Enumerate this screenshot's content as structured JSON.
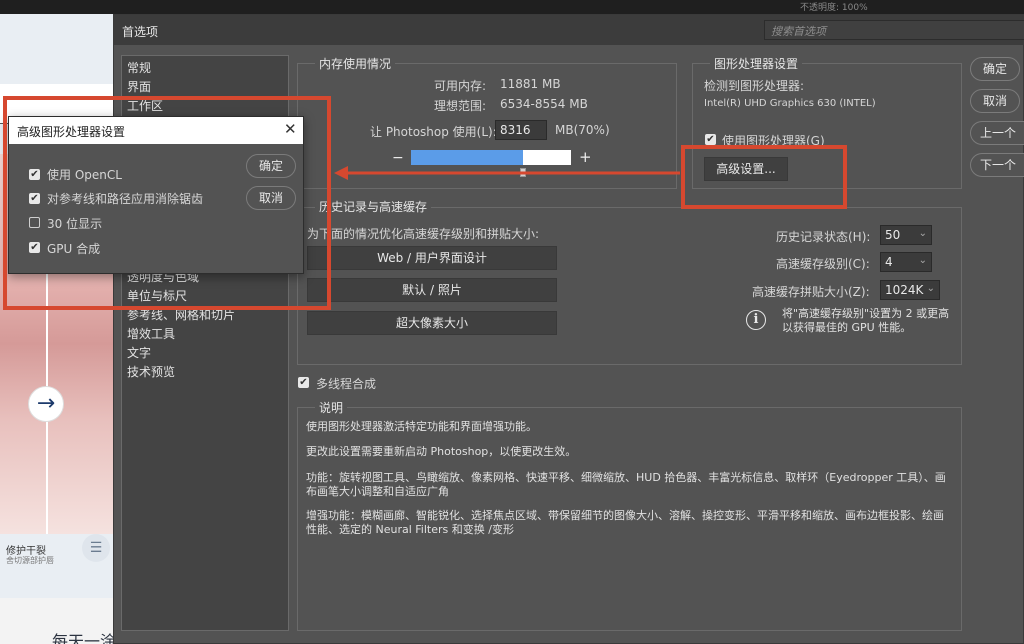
{
  "background_app": {
    "caption": "修护干裂",
    "caption_sub": "舍切源部护唇",
    "bottom_text": "每天一涂，唇部状态有待见",
    "arrow_glyph": "→",
    "menu_glyph": "☰",
    "right_top": "不透明度: 100%"
  },
  "window": {
    "title": "首选项",
    "search_placeholder": "搜索首选项"
  },
  "nav": {
    "items": [
      "常规",
      "界面",
      "工作区",
      "透明度与色域",
      "单位与标尺",
      "参考线、网格和切片",
      "增效工具",
      "文字",
      "技术预览"
    ]
  },
  "memory": {
    "legend": "内存使用情况",
    "available_label": "可用内存:",
    "available_value": "11881 MB",
    "ideal_label": "理想范围:",
    "ideal_value": "6534-8554 MB",
    "let_label": "让 Photoshop 使用(L):",
    "let_value": "8316",
    "let_unit": "MB(70%)",
    "minus": "−",
    "plus": "+",
    "usage_fraction": 0.7
  },
  "gpu": {
    "legend": "图形处理器设置",
    "detected_label": "检测到图形处理器:",
    "gpu_name": "Intel(R) UHD Graphics 630 (INTEL)",
    "use_gpu_label": "使用图形处理器(G)",
    "use_gpu_checked": true,
    "advanced_button": "高级设置..."
  },
  "actions": {
    "ok": "确定",
    "cancel": "取消",
    "prev": "上一个",
    "next": "下一个"
  },
  "history_cache": {
    "legend": "历史记录与高速缓存",
    "optimize_label": "为下面的情况优化高速缓存级别和拼贴大小:",
    "presets": [
      "Web / 用户界面设计",
      "默认 / 照片",
      "超大像素大小"
    ],
    "history_states_label": "历史记录状态(H):",
    "history_states_value": "50",
    "cache_levels_label": "高速缓存级别(C):",
    "cache_levels_value": "4",
    "tile_size_label": "高速缓存拼贴大小(Z):",
    "tile_size_value": "1024K",
    "tip": "将\"高速缓存级别\"设置为 2 或更高以获得最佳的 GPU 性能。",
    "info_glyph": "i"
  },
  "multithread": {
    "label": "多线程合成",
    "checked": true
  },
  "description": {
    "legend": "说明",
    "line1": "使用图形处理器激活特定功能和界面增强功能。",
    "line2": "更改此设置需要重新启动 Photoshop，以使更改生效。",
    "line3": "功能：旋转视图工具、鸟瞰缩放、像素网格、快速平移、细微缩放、HUD 拾色器、丰富光标信息、取样环（Eyedropper 工具）、画布画笔大小调整和自适应广角",
    "line4": "增强功能：模糊画廊、智能锐化、选择焦点区域、带保留细节的图像大小、溶解、操控变形、平滑平移和缩放、画布边框投影、绘画性能、选定的 Neural Filters 和变换 /变形"
  },
  "advanced_popup": {
    "title": "高级图形处理器设置",
    "close_glyph": "✕",
    "options": [
      {
        "label": "使用 OpenCL",
        "checked": true
      },
      {
        "label": "对参考线和路径应用消除锯齿",
        "checked": true
      },
      {
        "label": "30 位显示",
        "checked": false
      },
      {
        "label": "GPU 合成",
        "checked": true
      }
    ],
    "ok": "确定",
    "cancel": "取消"
  },
  "colors": {
    "highlight": "#d6482f",
    "slider_fill": "#5b9ce8",
    "dialog_bg": "#535353"
  },
  "checkmark": "✔"
}
